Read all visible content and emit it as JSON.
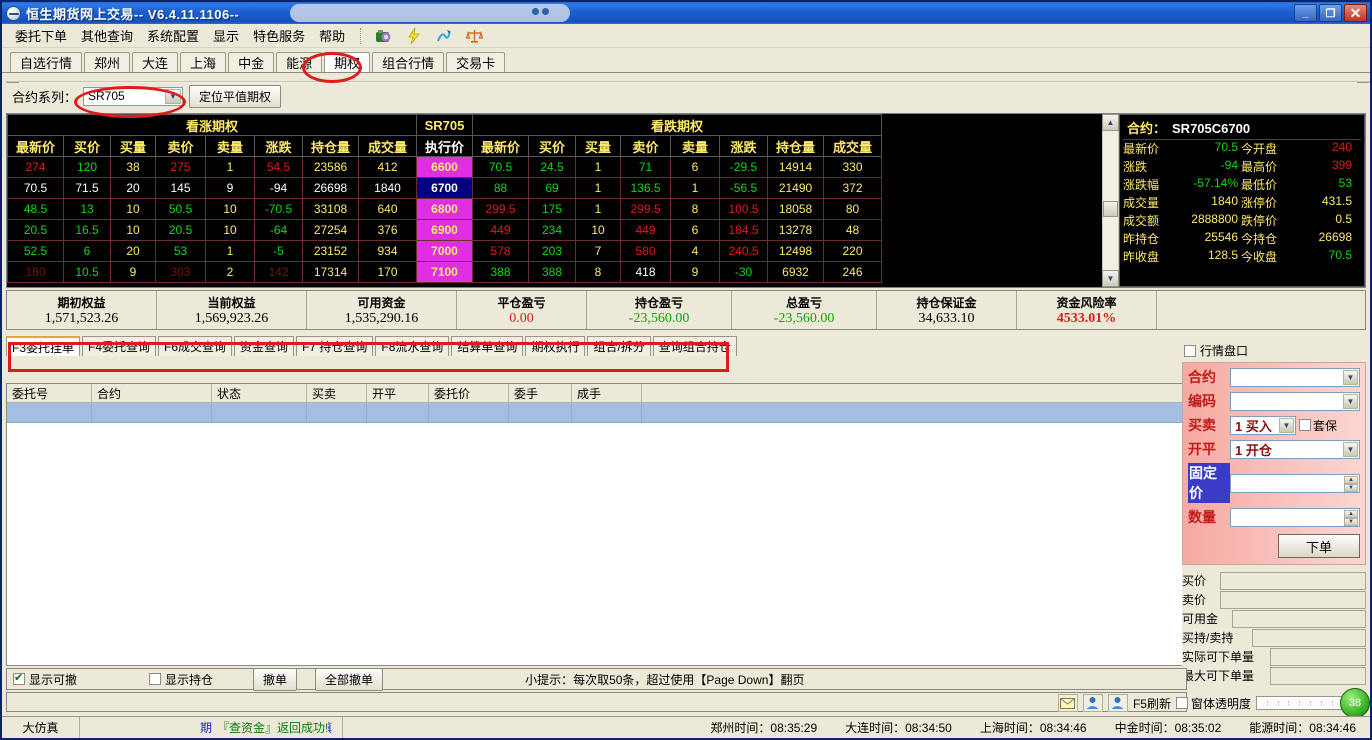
{
  "window": {
    "title": "恒生期货网上交易--  V6.4.11.1106--",
    "minimize": "_",
    "restore": "❐",
    "close": "✕"
  },
  "menu": {
    "items": [
      {
        "label": "委托下单"
      },
      {
        "label": "其他查询"
      },
      {
        "label": "系统配置"
      },
      {
        "label": "显示"
      },
      {
        "label": "特色服务"
      },
      {
        "label": "帮助"
      }
    ],
    "toolbar_icons": [
      "camera-icon",
      "lightning-icon",
      "chart-icon",
      "balance-icon"
    ]
  },
  "market_tabs": [
    {
      "label": "自选行情",
      "active": false
    },
    {
      "label": "郑州",
      "active": false
    },
    {
      "label": "大连",
      "active": false
    },
    {
      "label": "上海",
      "active": false
    },
    {
      "label": "中金",
      "active": false
    },
    {
      "label": "能源",
      "active": false
    },
    {
      "label": "期权",
      "active": true
    },
    {
      "label": "组合行情",
      "active": false
    },
    {
      "label": "交易卡",
      "active": false
    }
  ],
  "series_bar": {
    "label": "合约系列：",
    "selected": "SR705",
    "locate_button": "定位平值期权"
  },
  "option_table": {
    "call_title": "看涨期权",
    "put_title": "看跌期权",
    "series_title": "SR705",
    "call_headers": [
      "最新价",
      "买价",
      "买量",
      "卖价",
      "卖量",
      "涨跌",
      "持仓量",
      "成交量"
    ],
    "strike_header": "执行价",
    "put_headers": [
      "最新价",
      "买价",
      "买量",
      "卖价",
      "卖量",
      "涨跌",
      "持仓量",
      "成交量"
    ],
    "rows": [
      {
        "style": "row-a",
        "selected": false,
        "call": [
          "274",
          "120",
          "38",
          "275",
          "1",
          "54.5",
          "23586",
          "412"
        ],
        "call_colors": [
          "r",
          "g",
          "y",
          "r",
          "y",
          "r",
          "y",
          "y"
        ],
        "strike": "6600",
        "put": [
          "70.5",
          "24.5",
          "1",
          "71",
          "6",
          "-29.5",
          "14914",
          "330"
        ],
        "put_colors": [
          "g",
          "g",
          "y",
          "g",
          "y",
          "g",
          "y",
          "y"
        ],
        "put_style": "row-c"
      },
      {
        "style": "row-b",
        "selected": true,
        "call": [
          "70.5",
          "71.5",
          "20",
          "145",
          "9",
          "-94",
          "26698",
          "1840"
        ],
        "call_colors": [
          "w",
          "w",
          "w",
          "w",
          "w",
          "w",
          "w",
          "w"
        ],
        "strike": "6700",
        "put": [
          "88",
          "69",
          "1",
          "136.5",
          "1",
          "-56.5",
          "21490",
          "372"
        ],
        "put_colors": [
          "g",
          "g",
          "y",
          "g",
          "y",
          "g",
          "y",
          "y"
        ],
        "put_style": "row-d"
      },
      {
        "style": "row-c",
        "selected": false,
        "call": [
          "48.5",
          "13",
          "10",
          "50.5",
          "10",
          "-70.5",
          "33108",
          "640"
        ],
        "call_colors": [
          "g",
          "g",
          "y",
          "g",
          "y",
          "g",
          "y",
          "y"
        ],
        "strike": "6800",
        "put": [
          "299.5",
          "175",
          "1",
          "299.5",
          "8",
          "100.5",
          "18058",
          "80"
        ],
        "put_colors": [
          "r",
          "g",
          "y",
          "r",
          "y",
          "r",
          "y",
          "y"
        ],
        "put_style": "row-e"
      },
      {
        "style": "row-c",
        "selected": false,
        "call": [
          "20.5",
          "16.5",
          "10",
          "20.5",
          "10",
          "-64",
          "27254",
          "376"
        ],
        "call_colors": [
          "g",
          "g",
          "y",
          "g",
          "y",
          "g",
          "y",
          "y"
        ],
        "strike": "6900",
        "put": [
          "449",
          "234",
          "10",
          "449",
          "6",
          "184.5",
          "13278",
          "48"
        ],
        "put_colors": [
          "r",
          "g",
          "y",
          "r",
          "y",
          "r",
          "y",
          "y"
        ],
        "put_style": "row-e"
      },
      {
        "style": "row-c",
        "selected": false,
        "call": [
          "52.5",
          "6",
          "20",
          "53",
          "1",
          "-5",
          "23152",
          "934"
        ],
        "call_colors": [
          "g",
          "g",
          "y",
          "g",
          "y",
          "g",
          "y",
          "y"
        ],
        "strike": "7000",
        "put": [
          "578",
          "203",
          "7",
          "580",
          "4",
          "240.5",
          "12498",
          "220"
        ],
        "put_colors": [
          "r",
          "g",
          "y",
          "r",
          "y",
          "r",
          "y",
          "y"
        ],
        "put_style": "row-e"
      },
      {
        "style": "row-c",
        "selected": false,
        "call": [
          "180",
          "10.5",
          "9",
          "303",
          "2",
          "142",
          "17314",
          "170"
        ],
        "call_colors": [
          "k",
          "g",
          "y",
          "k",
          "y",
          "k",
          "y",
          "y"
        ],
        "strike": "7100",
        "put": [
          "388",
          "388",
          "8",
          "418",
          "9",
          "-30",
          "6932",
          "246"
        ],
        "put_colors": [
          "g",
          "g",
          "y",
          "w",
          "y",
          "g",
          "y",
          "y"
        ],
        "put_style": "row-e"
      }
    ]
  },
  "contract_info": {
    "title": "合约：",
    "contract": "SR705C6700",
    "fields": [
      {
        "label": "最新价",
        "value": "70.5",
        "color": "green",
        "label2": "今开盘",
        "value2": "240",
        "color2": "red"
      },
      {
        "label": "涨跌",
        "value": "-94",
        "color": "green",
        "label2": "最高价",
        "value2": "399",
        "color2": "red"
      },
      {
        "label": "涨跌幅",
        "value": "-57.14%",
        "color": "green",
        "label2": "最低价",
        "value2": "53",
        "color2": "green"
      },
      {
        "label": "成交量",
        "value": "1840",
        "color": "yellow",
        "label2": "涨停价",
        "value2": "431.5",
        "color2": "yellow"
      },
      {
        "label": "成交额",
        "value": "2888800",
        "color": "yellow",
        "label2": "跌停价",
        "value2": "0.5",
        "color2": "yellow"
      },
      {
        "label": "昨持仓",
        "value": "25546",
        "color": "yellow",
        "label2": "今持仓",
        "value2": "26698",
        "color2": "yellow"
      },
      {
        "label": "昨收盘",
        "value": "128.5",
        "color": "yellow",
        "label2": "今收盘",
        "value2": "70.5",
        "color2": "green"
      }
    ]
  },
  "summary": [
    {
      "label": "期初权益",
      "value": "1,571,523.26",
      "color": "black"
    },
    {
      "label": "当前权益",
      "value": "1,569,923.26",
      "color": "black"
    },
    {
      "label": "可用资金",
      "value": "1,535,290.16",
      "color": "black"
    },
    {
      "label": "平仓盈亏",
      "value": "0.00",
      "color": "red"
    },
    {
      "label": "持仓盈亏",
      "value": "-23,560.00",
      "color": "green"
    },
    {
      "label": "总盈亏",
      "value": "-23,560.00",
      "color": "green"
    },
    {
      "label": "持仓保证金",
      "value": "34,633.10",
      "color": "black"
    },
    {
      "label": "资金风险率",
      "value": "4533.01%",
      "color": "redb"
    }
  ],
  "lower_tabs": [
    {
      "label": "F3委托挂单",
      "active": true
    },
    {
      "label": "F4委托查询",
      "active": false
    },
    {
      "label": "F6成交查询",
      "active": false
    },
    {
      "label": "资金查询",
      "active": false
    },
    {
      "label": "F7 持仓查询",
      "active": false
    },
    {
      "label": "F8流水查询",
      "active": false
    },
    {
      "label": "结算单查询",
      "active": false
    },
    {
      "label": "期权执行",
      "active": false
    },
    {
      "label": "组合/拆分",
      "active": false
    },
    {
      "label": "查询组合持仓",
      "active": false
    }
  ],
  "order_list": {
    "headers": [
      "委托号",
      "合约",
      "状态",
      "买卖",
      "开平",
      "委托价",
      "委手",
      "成手"
    ],
    "rows": []
  },
  "right_panel": {
    "quote_checkbox": "行情盘口",
    "quote_checked": false,
    "form": {
      "contract_label": "合约",
      "contract_value": "",
      "code_label": "编码",
      "code_value": "",
      "side_label": "买卖",
      "side_value": "1  买入",
      "hedge_label": "套保",
      "hedge_checked": false,
      "openclose_label": "开平",
      "openclose_value": "1  开仓",
      "price_label": "固定价",
      "price_value": "",
      "qty_label": "数量",
      "qty_value": "",
      "submit_label": "下单"
    },
    "readouts": [
      {
        "label": "买价",
        "value": ""
      },
      {
        "label": "卖价",
        "value": ""
      },
      {
        "label": "可用金",
        "value": ""
      },
      {
        "label": "买持/卖持",
        "value": ""
      },
      {
        "label": "实际可下单量",
        "value": ""
      },
      {
        "label": "最大可下单量",
        "value": ""
      }
    ]
  },
  "bottom_bar": {
    "show_cancelable": "显示可撤",
    "show_cancelable_checked": true,
    "show_positions": "显示持仓",
    "show_positions_checked": false,
    "cancel_button": "撤单",
    "cancel_all_button": "全部撤单",
    "tip": "小提示：每次取50条，超过使用【Page Down】翻页"
  },
  "tool_strip": {
    "mail_icon": "mail-icon",
    "user_icon_1": "user-icon",
    "user_icon_2": "user-icon",
    "refresh_label": "F5刷新",
    "transparency_label": "窗体透明度",
    "transparency_checked": false,
    "badge": "38"
  },
  "status_bar": {
    "account": "大仿真",
    "risk_notice": "期市有风险，交易需谨慎",
    "response": "『查资金』返回成功!",
    "times": [
      {
        "label": "郑州时间：",
        "value": "08:35:29"
      },
      {
        "label": "大连时间：",
        "value": "08:34:50"
      },
      {
        "label": "上海时间：",
        "value": "08:34:46"
      },
      {
        "label": "中金时间：",
        "value": "08:35:02"
      },
      {
        "label": "能源时间：",
        "value": "08:34:46"
      }
    ]
  }
}
